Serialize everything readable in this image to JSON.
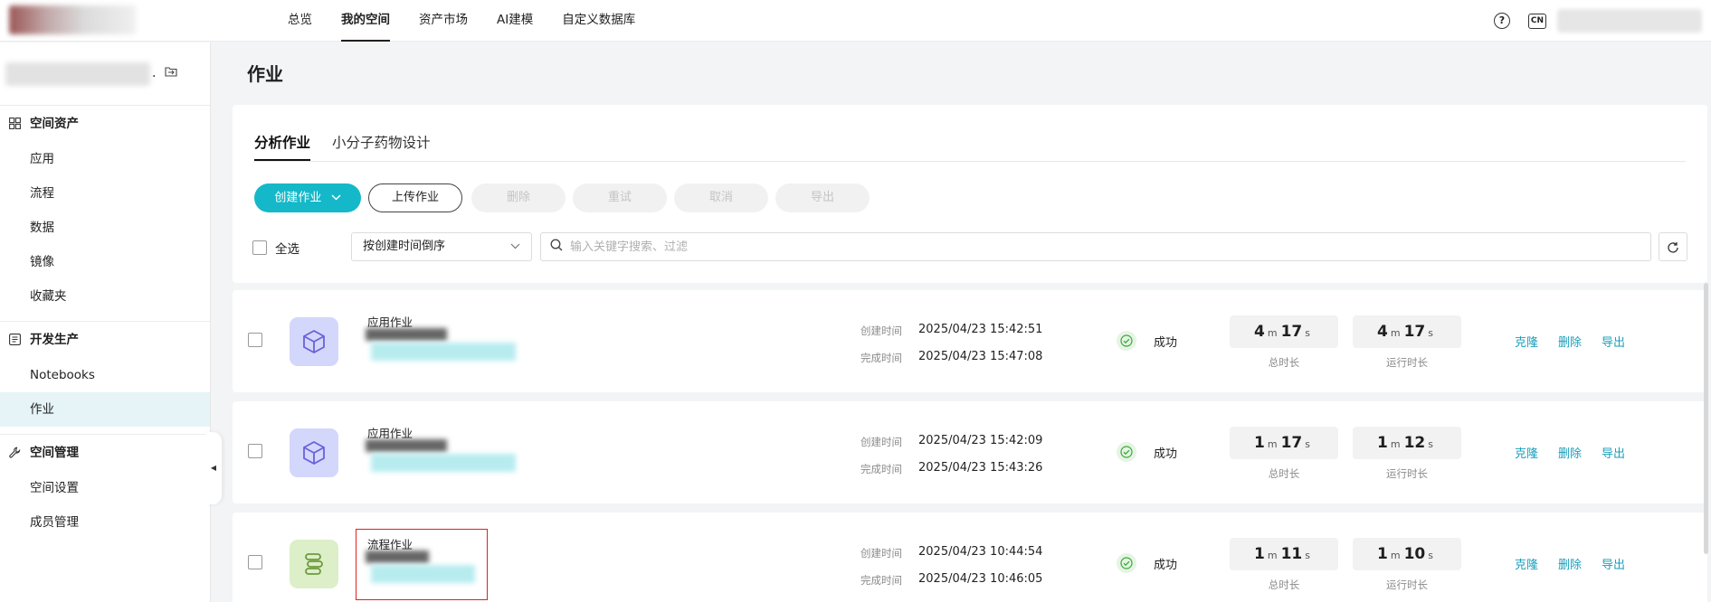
{
  "topnav": {
    "items": [
      "总览",
      "我的空间",
      "资产市场",
      "AI建模",
      "自定义数据库"
    ],
    "active": "我的空间",
    "help_icon": "?",
    "lang_badge": "CN"
  },
  "sidebar": {
    "space_dots": ".",
    "groups": [
      {
        "title": "空间资产",
        "icon": "grid-icon",
        "items": [
          "应用",
          "流程",
          "数据",
          "镜像",
          "收藏夹"
        ]
      },
      {
        "title": "开发生产",
        "icon": "notebook-icon",
        "items": [
          "Notebooks",
          "作业"
        ]
      },
      {
        "title": "空间管理",
        "icon": "wrench-icon",
        "items": [
          "空间设置",
          "成员管理"
        ]
      }
    ],
    "active_item": "作业"
  },
  "page": {
    "title": "作业",
    "tabs": [
      "分析作业",
      "小分子药物设计"
    ],
    "active_tab": "分析作业",
    "buttons": {
      "create": "创建作业",
      "upload": "上传作业",
      "delete": "删除",
      "retry": "重试",
      "cancel": "取消",
      "export": "导出"
    },
    "select_all": "全选",
    "sort": "按创建时间倒序",
    "search_placeholder": "输入关键字搜索、过滤"
  },
  "labels": {
    "created": "创建时间",
    "finished": "完成时间",
    "total": "总时长",
    "run": "运行时长",
    "clone": "克隆",
    "delete": "删除",
    "export": "导出",
    "m": "m",
    "s": "s"
  },
  "jobs": [
    {
      "type": "应用作业",
      "kind": "app",
      "created": "2025/04/23 15:42:51",
      "finished": "2025/04/23 15:47:08",
      "status": "成功",
      "total_m": "4",
      "total_s": "17",
      "run_m": "4",
      "run_s": "17"
    },
    {
      "type": "应用作业",
      "kind": "app",
      "created": "2025/04/23 15:42:09",
      "finished": "2025/04/23 15:43:26",
      "status": "成功",
      "total_m": "1",
      "total_s": "17",
      "run_m": "1",
      "run_s": "12"
    },
    {
      "type": "流程作业",
      "kind": "flow",
      "created": "2025/04/23 10:44:54",
      "finished": "2025/04/23 10:46:05",
      "status": "成功",
      "total_m": "1",
      "total_s": "11",
      "run_m": "1",
      "run_s": "10"
    }
  ],
  "colors": {
    "accent": "#14b8c9",
    "link": "#1a9ebb",
    "highlight": "#e02020",
    "active_sidebar": "#e6f4f7"
  }
}
